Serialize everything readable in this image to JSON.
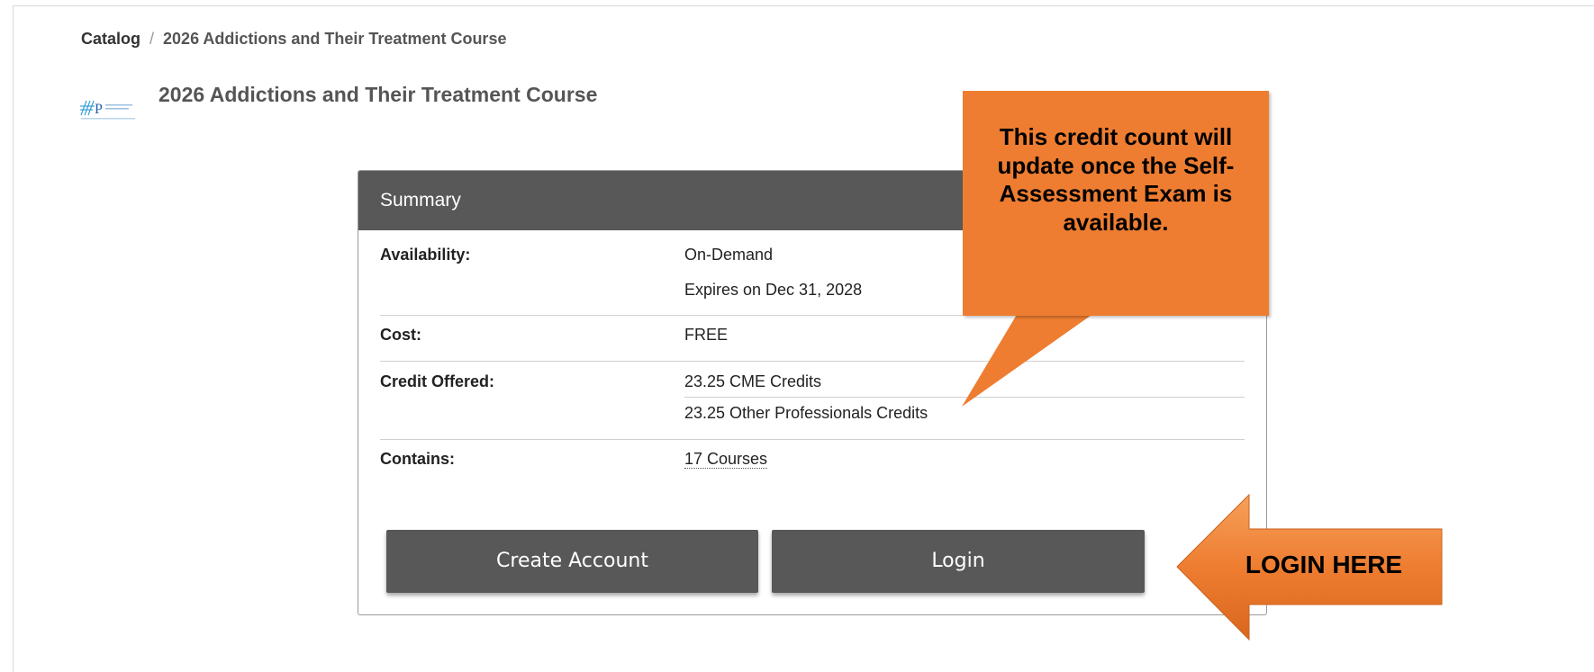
{
  "breadcrumb": {
    "root": "Catalog",
    "separator": "/",
    "current": "2026 Addictions and Their Treatment Course"
  },
  "page": {
    "title": "2026 Addictions and Their Treatment Course",
    "logo_icon": "aap-logo"
  },
  "summary": {
    "header": "Summary",
    "availability_label": "Availability:",
    "availability_value": "On-Demand",
    "expires_value": "Expires on Dec 31, 2028",
    "cost_label": "Cost:",
    "cost_value": "FREE",
    "credit_label": "Credit Offered:",
    "credit_cme": "23.25 CME Credits",
    "credit_other": "23.25 Other Professionals Credits",
    "contains_label": "Contains:",
    "contains_value": "17 Courses"
  },
  "buttons": {
    "create_account": "Create Account",
    "login": "Login"
  },
  "annotations": {
    "callout_text": "This credit count will update once the Self-Assessment Exam is available.",
    "arrow_text": "LOGIN HERE",
    "accent_color": "#ee7d31"
  }
}
